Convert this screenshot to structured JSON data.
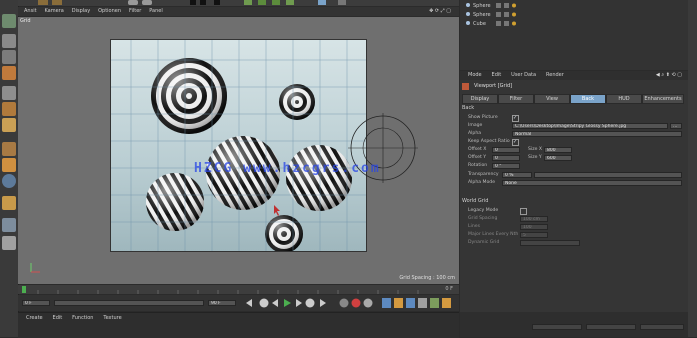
{
  "viewport": {
    "menu": [
      "Ansit",
      "Kamera",
      "Display",
      "Optionen",
      "Filter",
      "Panel"
    ],
    "title": "Grid",
    "grid_spacing": "Grid Spacing : 100 cm",
    "watermark": "HZCG www.hzcgrs.com"
  },
  "timeline": {
    "start_frame": "0 F",
    "end_frame": "0 F",
    "frame_field": "0 F",
    "end_field": "90 F"
  },
  "bottom_menu": [
    "Create",
    "Edit",
    "Function",
    "Texture"
  ],
  "objects": [
    {
      "name": "Sphere"
    },
    {
      "name": "Sphere"
    },
    {
      "name": "Cube"
    }
  ],
  "attr": {
    "menu": [
      "Mode",
      "Edit",
      "User Data",
      "Render"
    ],
    "object_title": "Viewport [Grid]",
    "tabs": [
      "Display",
      "Filter",
      "View",
      "Back",
      "HUD",
      "Enhancements"
    ],
    "active_tab": "Back",
    "section_back": "Back",
    "rows": {
      "show_picture": {
        "label": "Show Picture",
        "checked": true
      },
      "image": {
        "label": "Image",
        "value": "C:\\Users\\Desktop\\Image\\Stripy Glossy Sphere.jpg"
      },
      "alpha": {
        "label": "Alpha",
        "value": "Normal"
      },
      "keep_aspect": {
        "label": "Keep Aspect Ratio",
        "checked": true
      },
      "offset_x": {
        "label": "Offset X",
        "value": "0"
      },
      "offset_y": {
        "label": "Offset Y",
        "value": "0"
      },
      "size_x": {
        "label": "Size X",
        "value": "800"
      },
      "size_y": {
        "label": "Size Y",
        "value": "600"
      },
      "rotation": {
        "label": "Rotation",
        "value": "0 °"
      },
      "transparency": {
        "label": "Transparency",
        "value": "0 %"
      },
      "alpha_mode": {
        "label": "Alpha Mode",
        "value": "None"
      }
    },
    "section_world": "World Grid",
    "world_rows": {
      "legacy": {
        "label": "Legacy Mode",
        "checked": false
      },
      "grid_spacing": {
        "label": "Grid Spacing",
        "value": "100 cm"
      },
      "lines": {
        "label": "Lines",
        "value": "100"
      },
      "major": {
        "label": "Major Lines Every Nth",
        "value": "5"
      },
      "dynamic_grid": {
        "label": "Dynamic Grid",
        "value": ""
      }
    }
  },
  "colors": {
    "accent": "#7aa3c9",
    "watermark": "#2846e6",
    "panel_bg": "#353535",
    "viewport_bg": "#6f6f6f"
  }
}
